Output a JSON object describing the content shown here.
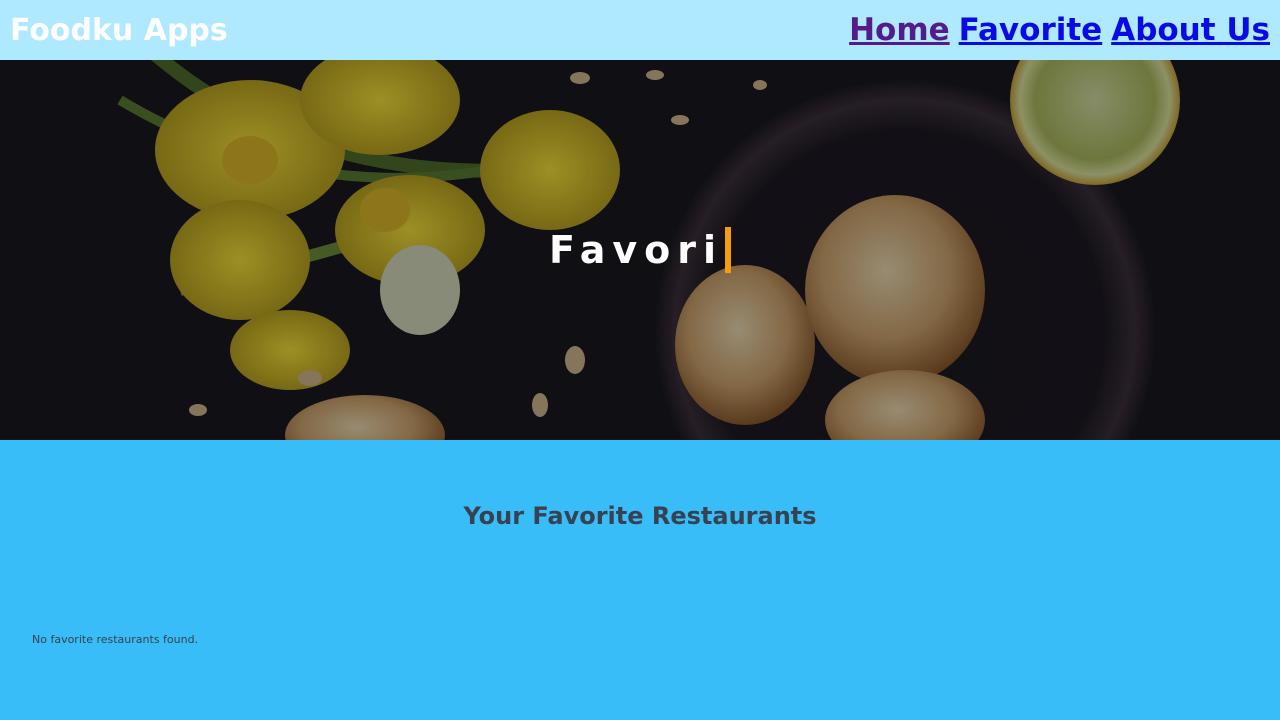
{
  "navbar": {
    "brand": "Foodku Apps",
    "links": [
      {
        "label": "Home",
        "visited": true
      },
      {
        "label": "Favorite",
        "visited": false
      },
      {
        "label": "About Us",
        "visited": false
      }
    ]
  },
  "hero": {
    "typed_title": "Favori"
  },
  "main": {
    "section_title": "Your Favorite Restaurants",
    "empty_message": "No favorite restaurants found."
  },
  "colors": {
    "navbar_bg": "#aee9ff",
    "page_bg": "#38bdf8",
    "caret": "#f59e0b",
    "link": "#0a0ae6",
    "link_visited": "#551a8b"
  },
  "icons": []
}
